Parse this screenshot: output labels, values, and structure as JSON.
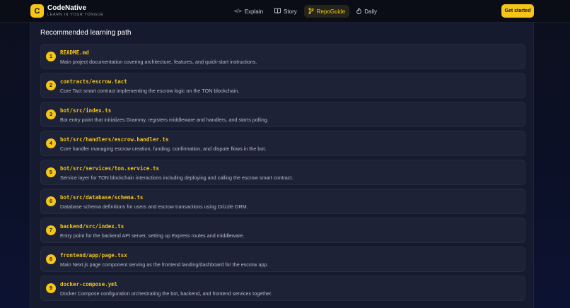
{
  "brand": {
    "logo_letter": "C",
    "name": "CodeNative",
    "tagline": "LEARN IN YOUR TONGUE"
  },
  "nav": [
    {
      "label": "Explain",
      "icon": "code-icon",
      "glyph": "</>",
      "active": false
    },
    {
      "label": "Story",
      "icon": "book-icon",
      "glyph": "▯▯",
      "active": false
    },
    {
      "label": "RepoGuide",
      "icon": "git-branch-icon",
      "glyph": "ᛘ",
      "active": true
    },
    {
      "label": "Daily",
      "icon": "flame-icon",
      "glyph": "♨",
      "active": false
    }
  ],
  "cta_label": "Get started",
  "colors": {
    "accent": "#f5c518",
    "background": "#0b1024",
    "card": "#1d2236"
  },
  "section_title": "Recommended learning path",
  "items": [
    {
      "num": "1",
      "path": "README.md",
      "desc": "Main project documentation covering architecture, features, and quick-start instructions."
    },
    {
      "num": "2",
      "path": "contracts/escrow.tact",
      "desc": "Core Tact smart contract implementing the escrow logic on the TON blockchain."
    },
    {
      "num": "3",
      "path": "bot/src/index.ts",
      "desc": "Bot entry point that initializes Grammy, registers middleware and handlers, and starts polling."
    },
    {
      "num": "4",
      "path": "bot/src/handlers/escrow.handler.ts",
      "desc": "Core handler managing escrow creation, funding, confirmation, and dispute flows in the bot."
    },
    {
      "num": "5",
      "path": "bot/src/services/ton.service.ts",
      "desc": "Service layer for TON blockchain interactions including deploying and calling the escrow smart contract."
    },
    {
      "num": "6",
      "path": "bot/src/database/schema.ts",
      "desc": "Database schema definitions for users and escrow transactions using Drizzle ORM."
    },
    {
      "num": "7",
      "path": "backend/src/index.ts",
      "desc": "Entry point for the backend API server, setting up Express routes and middleware."
    },
    {
      "num": "8",
      "path": "frontend/app/page.tsx",
      "desc": "Main Next.js page component serving as the frontend landing/dashboard for the escrow app."
    },
    {
      "num": "9",
      "path": "docker-compose.yml",
      "desc": "Docker Compose configuration orchestrating the bot, backend, and frontend services together."
    }
  ]
}
